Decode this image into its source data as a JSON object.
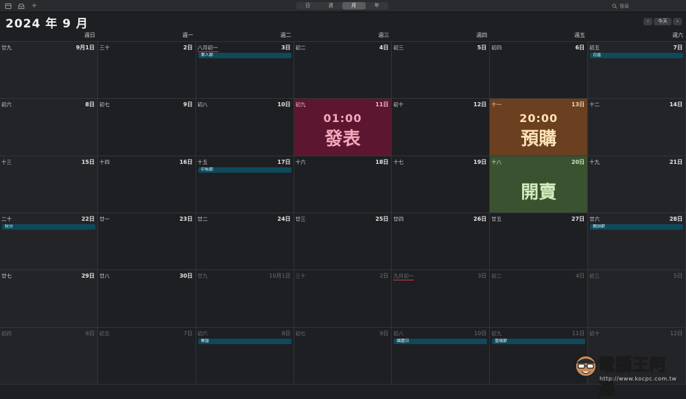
{
  "toolbar": {
    "icons": [
      "calendar-list-icon",
      "inbox-icon",
      "add-icon"
    ],
    "add_glyph": "+",
    "views": [
      {
        "label": "日",
        "active": false
      },
      {
        "label": "週",
        "active": false
      },
      {
        "label": "月",
        "active": true
      },
      {
        "label": "年",
        "active": false
      }
    ],
    "search_placeholder": "搜尋"
  },
  "header": {
    "title": "2024 年 9 月",
    "prev": "‹",
    "today": "今天",
    "next": "›"
  },
  "weekdays": [
    "週日",
    "週一",
    "週二",
    "週三",
    "週四",
    "週五",
    "週六"
  ],
  "weeks": [
    [
      {
        "lunar": "廿九",
        "day": "9月1日",
        "other": false
      },
      {
        "lunar": "三十",
        "day": "2日",
        "other": false
      },
      {
        "lunar": "八月初一",
        "day": "3日",
        "other": false,
        "event": "軍人節",
        "underline": true
      },
      {
        "lunar": "初二",
        "day": "4日",
        "other": false
      },
      {
        "lunar": "初三",
        "day": "5日",
        "other": false
      },
      {
        "lunar": "初四",
        "day": "6日",
        "other": false
      },
      {
        "lunar": "初五",
        "day": "7日",
        "other": false,
        "event": "白露"
      }
    ],
    [
      {
        "lunar": "初六",
        "day": "8日",
        "other": false
      },
      {
        "lunar": "初七",
        "day": "9日",
        "other": false
      },
      {
        "lunar": "初八",
        "day": "10日",
        "other": false
      },
      {
        "lunar": "初九",
        "day": "11日",
        "other": false,
        "highlight": "red",
        "overlay_time": "01:00",
        "overlay_text": "發表"
      },
      {
        "lunar": "初十",
        "day": "12日",
        "other": false
      },
      {
        "lunar": "十一",
        "day": "13日",
        "other": false,
        "highlight": "orange",
        "overlay_time": "20:00",
        "overlay_text": "預購"
      },
      {
        "lunar": "十二",
        "day": "14日",
        "other": false
      }
    ],
    [
      {
        "lunar": "十三",
        "day": "15日",
        "other": false
      },
      {
        "lunar": "十四",
        "day": "16日",
        "other": false
      },
      {
        "lunar": "十五",
        "day": "17日",
        "other": false,
        "event": "中秋節"
      },
      {
        "lunar": "十六",
        "day": "18日",
        "other": false
      },
      {
        "lunar": "十七",
        "day": "19日",
        "other": false
      },
      {
        "lunar": "十八",
        "day": "20日",
        "other": false,
        "highlight": "green",
        "overlay_text": "開賣"
      },
      {
        "lunar": "十九",
        "day": "21日",
        "other": false
      }
    ],
    [
      {
        "lunar": "二十",
        "day": "22日",
        "other": false,
        "event": "秋分"
      },
      {
        "lunar": "廿一",
        "day": "23日",
        "other": false
      },
      {
        "lunar": "廿二",
        "day": "24日",
        "other": false
      },
      {
        "lunar": "廿三",
        "day": "25日",
        "other": false
      },
      {
        "lunar": "廿四",
        "day": "26日",
        "other": false
      },
      {
        "lunar": "廿五",
        "day": "27日",
        "other": false
      },
      {
        "lunar": "廿六",
        "day": "28日",
        "other": false,
        "event": "教師節"
      }
    ],
    [
      {
        "lunar": "廿七",
        "day": "29日",
        "other": false
      },
      {
        "lunar": "廿八",
        "day": "30日",
        "other": false
      },
      {
        "lunar": "廿九",
        "day": "10月1日",
        "other": true
      },
      {
        "lunar": "三十",
        "day": "2日",
        "other": true
      },
      {
        "lunar": "九月初一",
        "day": "3日",
        "other": true,
        "underline": true
      },
      {
        "lunar": "初二",
        "day": "4日",
        "other": true
      },
      {
        "lunar": "初三",
        "day": "5日",
        "other": true
      }
    ],
    [
      {
        "lunar": "初四",
        "day": "6日",
        "other": true
      },
      {
        "lunar": "初五",
        "day": "7日",
        "other": true
      },
      {
        "lunar": "初六",
        "day": "8日",
        "other": true,
        "event": "寒露"
      },
      {
        "lunar": "初七",
        "day": "9日",
        "other": true
      },
      {
        "lunar": "初八",
        "day": "10日",
        "other": true,
        "event": "國慶日"
      },
      {
        "lunar": "初九",
        "day": "11日",
        "other": true,
        "event": "重陽節"
      },
      {
        "lunar": "初十",
        "day": "12日",
        "other": true
      }
    ]
  ],
  "watermark": {
    "text": "電腦王阿達",
    "url": "http://www.kocpc.com.tw"
  }
}
